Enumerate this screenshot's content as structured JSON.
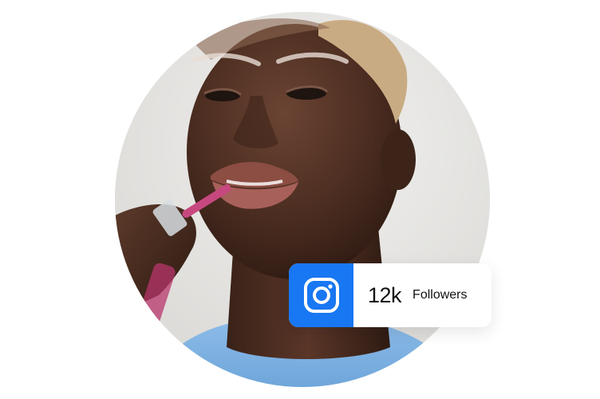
{
  "portrait": {
    "image_name": "person-applying-lip-gloss-photo"
  },
  "badge": {
    "icon": "instagram-icon",
    "count": "12k",
    "label": "Followers",
    "accent_color": "#1877f2",
    "card_color": "#ffffff"
  }
}
